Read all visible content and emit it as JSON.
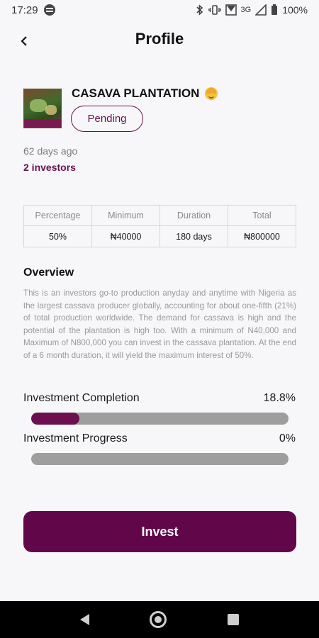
{
  "status_bar": {
    "time": "17:29",
    "network": "3G",
    "battery": "100%"
  },
  "header": {
    "title": "Profile",
    "back_icon": "chevron-left-icon"
  },
  "product": {
    "name": "CASAVA PLANTATION",
    "status": "Pending",
    "time_ago": "62 days ago",
    "investors": "2 investors"
  },
  "stats": {
    "headers": [
      "Percentage",
      "Minimum",
      "Duration",
      "Total"
    ],
    "values": [
      "50%",
      "₦40000",
      "180 days",
      "₦800000"
    ]
  },
  "overview": {
    "title": "Overview",
    "text": "This is an investors go-to production anyday and anytime with Nigeria as the largest cassava producer globally, accounting for about one-fifth (21%) of total production worldwide. The demand for cassava  is high and the potential of the plantation is high too. With a minimum of N40,000 and  Maximum of N800,000 you can invest in the cassava plantation. At the end of a 6 month duration, it will yield the maximum interest of 50%."
  },
  "completion": {
    "label": "Investment Completion",
    "value": "18.8%",
    "fraction": 0.188
  },
  "progress": {
    "label": "Investment Progress",
    "value": "0%",
    "fraction": 0
  },
  "invest_button": {
    "label": "Invest"
  },
  "colors": {
    "accent": "#6b0f4e",
    "button": "#62064a",
    "track": "#9e9e9e",
    "background": "#f7f7f9"
  }
}
